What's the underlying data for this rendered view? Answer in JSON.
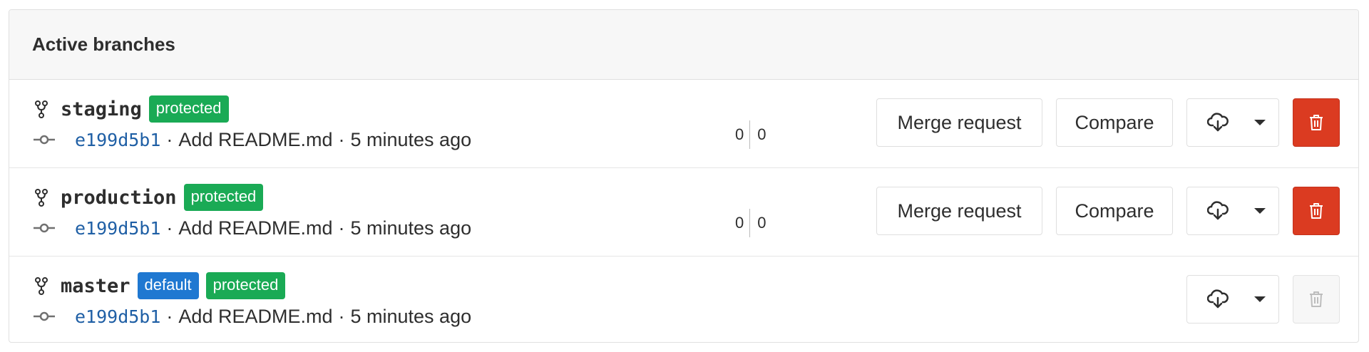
{
  "panel": {
    "title": "Active branches"
  },
  "branches": [
    {
      "name": "staging",
      "badges": [
        {
          "label": "protected",
          "color": "#1aaa55"
        }
      ],
      "commit": {
        "sha": "e199d5b1",
        "message": "Add README.md",
        "time": "5 minutes ago"
      },
      "divergence": {
        "behind": "0",
        "ahead": "0"
      },
      "buttons": {
        "merge_request": "Merge request",
        "compare": "Compare"
      },
      "delete_enabled": true
    },
    {
      "name": "production",
      "badges": [
        {
          "label": "protected",
          "color": "#1aaa55"
        }
      ],
      "commit": {
        "sha": "e199d5b1",
        "message": "Add README.md",
        "time": "5 minutes ago"
      },
      "divergence": {
        "behind": "0",
        "ahead": "0"
      },
      "buttons": {
        "merge_request": "Merge request",
        "compare": "Compare"
      },
      "delete_enabled": true
    },
    {
      "name": "master",
      "badges": [
        {
          "label": "default",
          "color": "#1f78d1"
        },
        {
          "label": "protected",
          "color": "#1aaa55"
        }
      ],
      "commit": {
        "sha": "e199d5b1",
        "message": "Add README.md",
        "time": "5 minutes ago"
      },
      "delete_enabled": false
    }
  ],
  "separator": "·",
  "icons": {
    "branch": "branch-icon",
    "commit": "commit-icon",
    "download": "cloud-download-icon",
    "caret": "chevron-down-icon",
    "delete": "trash-icon"
  },
  "colors": {
    "protected_badge": "#1aaa55",
    "default_badge": "#1f78d1",
    "danger": "#db3b21",
    "sha_link": "#1f5fa5"
  }
}
